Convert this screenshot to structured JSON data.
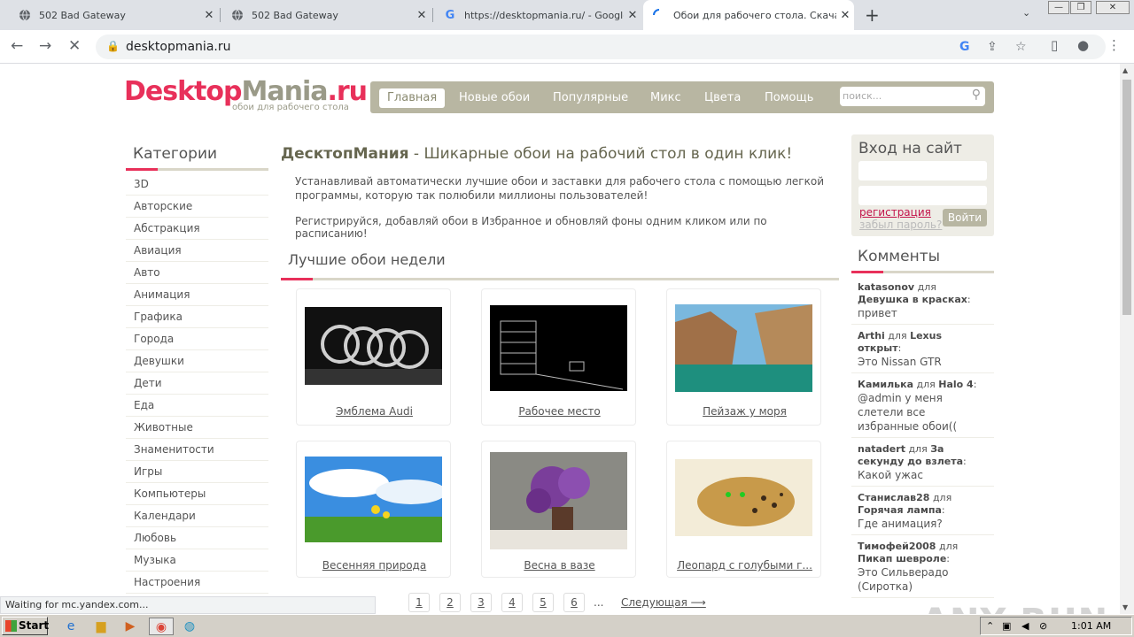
{
  "browser": {
    "tabs": [
      {
        "title": "502 Bad Gateway",
        "favicon": "globe-icon"
      },
      {
        "title": "502 Bad Gateway",
        "favicon": "globe-icon"
      },
      {
        "title": "https://desktopmania.ru/ - Google S",
        "favicon": "google-icon"
      },
      {
        "title": "Обои для рабочего стола. Скачат",
        "favicon": "loading-icon"
      }
    ],
    "url": "desktopmania.ru",
    "status_text": "Waiting for mc.yandex.com..."
  },
  "site": {
    "logo_part1": "Desktop",
    "logo_part2": "Mania",
    "logo_part3": ".ru",
    "logo_tagline": "обои для рабочего стола",
    "menu": [
      "Главная",
      "Новые обои",
      "Популярные",
      "Микс",
      "Цвета",
      "Помощь"
    ],
    "search_placeholder": "поиск...",
    "categories_title": "Категории",
    "categories": [
      "3D",
      "Авторские",
      "Абстракция",
      "Авиация",
      "Авто",
      "Анимация",
      "Графика",
      "Города",
      "Девушки",
      "Дети",
      "Еда",
      "Животные",
      "Знаменитости",
      "Игры",
      "Компьютеры",
      "Календари",
      "Любовь",
      "Музыка",
      "Настроения"
    ],
    "hero_brand": "ДесктопМания",
    "hero_rest": " - Шикарные обои на рабочий стол в один клик!",
    "intro1": "Устанавливай автоматически лучшие обои и заставки для рабочего стола с помощью легкой программы, которую так полюбили миллионы пользователей!",
    "intro2": "Регистрируйся, добавляй обои в Избранное и обновляй фоны одним кликом или по расписанию!",
    "best_title": "Лучшие обои недели",
    "wallpapers": [
      "Эмблема Audi",
      "Рабочее место",
      "Пейзаж у моря",
      "Весенняя природа",
      "Весна в вазе",
      "Леопард с голубыми г..."
    ],
    "pages": [
      "1",
      "2",
      "3",
      "4",
      "5",
      "6"
    ],
    "pager_dots": "...",
    "pager_next": "Следующая ⟶",
    "login_title": "Вход на сайт",
    "register_link": "регистрация",
    "forgot_link": "забыл пароль?",
    "login_button": "Войти",
    "comments_title": "Комменты",
    "comments": [
      {
        "user": "katasonov",
        "for": " для ",
        "item": "Девушка в красках",
        "text": "привет"
      },
      {
        "user": "Arthi",
        "for": " для ",
        "item": "Lexus открыт",
        "text": "Это Nissan GTR"
      },
      {
        "user": "Камилька",
        "for": " для ",
        "item": "Halo 4",
        "text": "@admin у меня слетели все избранные обои(("
      },
      {
        "user": "natadert",
        "for": " для ",
        "item": "За секунду до взлета",
        "text": "Какой ужас"
      },
      {
        "user": "Станислав28",
        "for": " для ",
        "item": "Горячая лампа",
        "text": "Где анимация?"
      },
      {
        "user": "Тимофей2008",
        "for": " для ",
        "item": "Пикап шевроле",
        "text": "Это Сильверадо (Сиротка)"
      }
    ]
  },
  "taskbar": {
    "start": "Start",
    "clock": "1:01 AM"
  },
  "watermark": "ANY RUN",
  "colors": {
    "accent": "#e8305a",
    "menu_bg": "#b8b6a2",
    "panel_bg": "#eeede6"
  }
}
